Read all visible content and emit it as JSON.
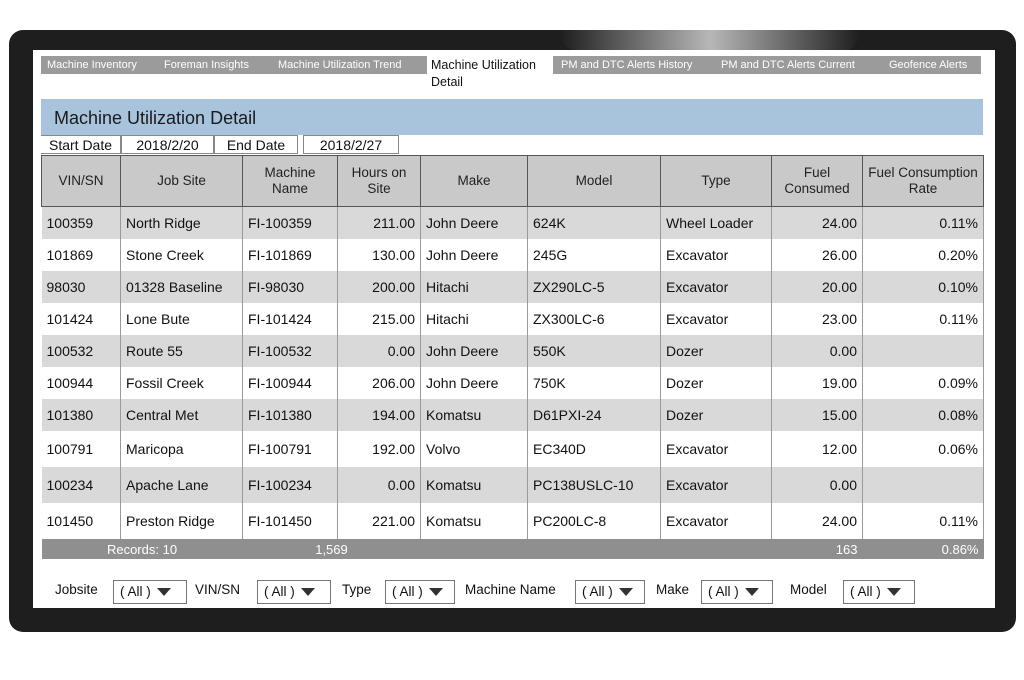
{
  "tabs": [
    {
      "label": "Machine Inventory"
    },
    {
      "label": "Foreman Insights"
    },
    {
      "label": "Machine Utilization Trend"
    },
    {
      "label": "Machine Utilization Detail"
    },
    {
      "label": "PM and DTC Alerts History"
    },
    {
      "label": "PM and DTC Alerts Current"
    },
    {
      "label": "Geofence Alerts"
    }
  ],
  "page_title": "Machine Utilization Detail",
  "dates": {
    "start_label": "Start Date",
    "start_value": "2018/2/20",
    "end_label": "End Date",
    "end_value": "2018/2/27"
  },
  "columns": [
    "VIN/SN",
    "Job Site",
    "Machine Name",
    "Hours on Site",
    "Make",
    "Model",
    "Type",
    "Fuel Consumed",
    "Fuel Consumption Rate"
  ],
  "rows": [
    [
      "100359",
      "North Ridge",
      "FI-100359",
      "211.00",
      "John Deere",
      "624K",
      "Wheel Loader",
      "24.00",
      "0.11%"
    ],
    [
      "101869",
      "Stone Creek",
      "FI-101869",
      "130.00",
      "John Deere",
      "245G",
      "Excavator",
      "26.00",
      "0.20%"
    ],
    [
      "98030",
      "01328 Baseline",
      "FI-98030",
      "200.00",
      "Hitachi",
      "ZX290LC-5",
      "Excavator",
      "20.00",
      "0.10%"
    ],
    [
      "101424",
      "Lone Bute",
      "FI-101424",
      "215.00",
      "Hitachi",
      "ZX300LC-6",
      "Excavator",
      "23.00",
      "0.11%"
    ],
    [
      "100532",
      "Route 55",
      "FI-100532",
      "0.00",
      "John Deere",
      "550K",
      "Dozer",
      "0.00",
      ""
    ],
    [
      "100944",
      "Fossil Creek",
      "FI-100944",
      "206.00",
      "John Deere",
      "750K",
      "Dozer",
      "19.00",
      "0.09%"
    ],
    [
      "101380",
      "Central Met",
      "FI-101380",
      "194.00",
      "Komatsu",
      "D61PXI-24",
      "Dozer",
      "15.00",
      "0.08%"
    ],
    [
      "100791",
      "Maricopa",
      "FI-100791",
      "192.00",
      "Volvo",
      "EC340D",
      "Excavator",
      "12.00",
      "0.06%"
    ],
    [
      "100234",
      "Apache Lane",
      "FI-100234",
      "0.00",
      "Komatsu",
      "PC138USLC-10",
      "Excavator",
      "0.00",
      ""
    ],
    [
      "101450",
      "Preston Ridge",
      "FI-101450",
      "221.00",
      "Komatsu",
      "PC200LC-8",
      "Excavator",
      "24.00",
      "0.11%"
    ]
  ],
  "footer": {
    "records": "Records: 10",
    "hours_total": "1,569",
    "fuel_total": "163",
    "rate_total": "0.86%"
  },
  "filters": [
    {
      "label": "Jobsite",
      "value": "( All )"
    },
    {
      "label": "VIN/SN",
      "value": "( All )"
    },
    {
      "label": "Type",
      "value": "( All )"
    },
    {
      "label": "Machine Name",
      "value": "( All )"
    },
    {
      "label": "Make",
      "value": "( All )"
    },
    {
      "label": "Model",
      "value": "( All )"
    }
  ],
  "colors": {
    "title_bar": "#a8c4dd",
    "tab_bar": "#9b9b9b",
    "row_shade": "#d9d9d9",
    "footer": "#8f8f8f"
  }
}
